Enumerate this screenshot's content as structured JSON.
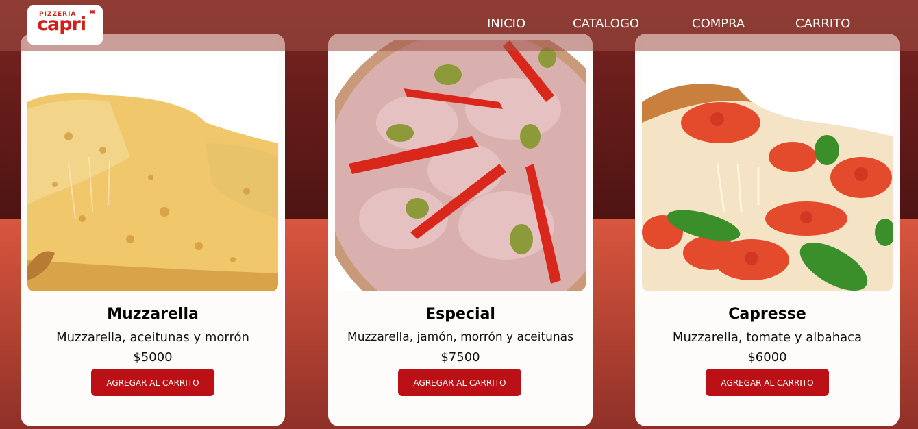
{
  "header": {
    "logo_small": "PIZZERIA",
    "logo_big": "capri",
    "nav": [
      "INICIO",
      "CATALOGO",
      "COMPRA",
      "CARRITO"
    ]
  },
  "products": [
    {
      "name": "Muzzarella",
      "description": "Muzzarella, aceitunas y morrón",
      "price": "$5000",
      "button": "AGREGAR AL CARRITO"
    },
    {
      "name": "Especial",
      "description": "Muzzarella, jamón, morrón y aceitunas",
      "price": "$7500",
      "button": "AGREGAR AL CARRITO"
    },
    {
      "name": "Capresse",
      "description": "Muzzarella, tomate y albahaca",
      "price": "$6000",
      "button": "AGREGAR AL CARRITO"
    }
  ],
  "colors": {
    "brand_red": "#d0201a",
    "button_red": "#bb1116",
    "header_overlay": "#a05046"
  },
  "icons": [
    "pizzeria-logo",
    "muzzarella-pizza-image",
    "especial-pizza-image",
    "capresse-pizza-image"
  ]
}
